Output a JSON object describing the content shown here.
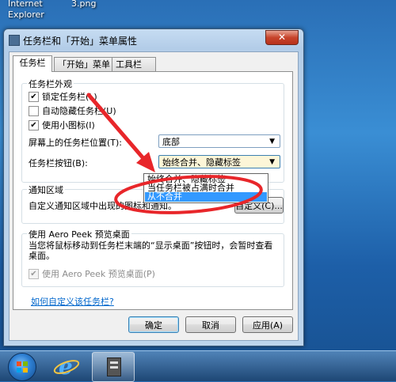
{
  "desktop": {
    "icons": [
      {
        "label_line1": "Internet",
        "label_line2": "Explorer"
      },
      {
        "label_line1": "3.png"
      }
    ]
  },
  "window": {
    "title": "任务栏和「开始」菜单属性",
    "close_glyph": "✕",
    "tabs": [
      "任务栏",
      "「开始」菜单",
      "工具栏"
    ],
    "appearance_group": {
      "legend": "任务栏外观",
      "checkboxes": [
        {
          "label": "锁定任务栏(L)",
          "checked": true
        },
        {
          "label": "自动隐藏任务栏(U)",
          "checked": false
        },
        {
          "label": "使用小图标(I)",
          "checked": true
        }
      ],
      "location_label": "屏幕上的任务栏位置(T):",
      "location_value": "底部",
      "buttons_label": "任务栏按钮(B):",
      "buttons_value": "始终合并、隐藏标签",
      "buttons_options": [
        "始终合并、隐藏标签",
        "当任务栏被占满时合并",
        "从不合并"
      ],
      "selected_option_index": 2
    },
    "notification_group": {
      "legend": "通知区域",
      "text": "自定义通知区域中出现的图标和通知。",
      "customize_button": "自定义(C)..."
    },
    "aeropeek_group": {
      "legend": "使用 Aero Peek 预览桌面",
      "description": "当您将鼠标移动到任务栏末端的“显示桌面”按钮时，会暂时查看桌面。",
      "checkbox_label": "使用 Aero Peek 预览桌面(P)",
      "checkbox_checked": true
    },
    "help_link": "如何自定义该任务栏?",
    "buttons": {
      "ok": "确定",
      "cancel": "取消",
      "apply": "应用(A)"
    }
  },
  "annotation": {
    "color": "#e8262a"
  }
}
